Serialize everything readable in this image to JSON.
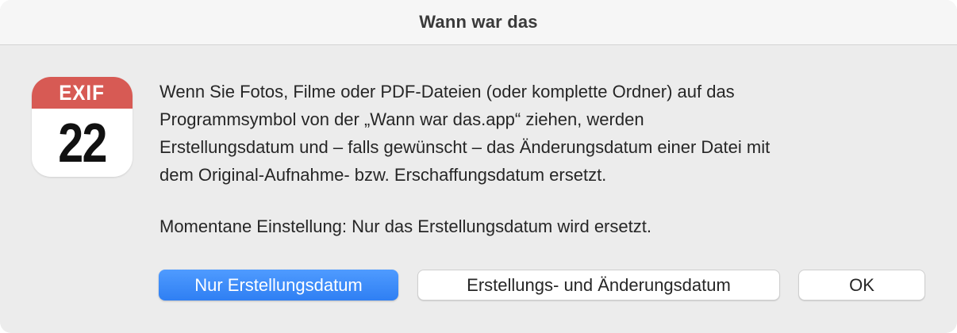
{
  "window": {
    "title": "Wann war das"
  },
  "app_icon": {
    "band_label": "EXIF",
    "day_number": "22",
    "band_color": "#d75a54"
  },
  "message": {
    "lines": [
      "Wenn Sie Fotos, Filme oder PDF-Dateien (oder komplette Ordner) auf das",
      "Programmsymbol von der „Wann war das.app“ ziehen, werden",
      "Erstellungsdatum und – falls gewünscht – das Änderungsdatum einer Datei mit",
      "dem Original-Aufnahme- bzw. Erschaffungsdatum ersetzt."
    ],
    "current_setting": "Momentane Einstellung: Nur das Erstellungsdatum wird ersetzt."
  },
  "buttons": {
    "creation_only": "Nur Erstellungsdatum",
    "creation_and_modification": "Erstellungs- und Änderungsdatum",
    "ok": "OK"
  },
  "colors": {
    "default_button": "#2f7ff3",
    "background": "#ececec"
  }
}
